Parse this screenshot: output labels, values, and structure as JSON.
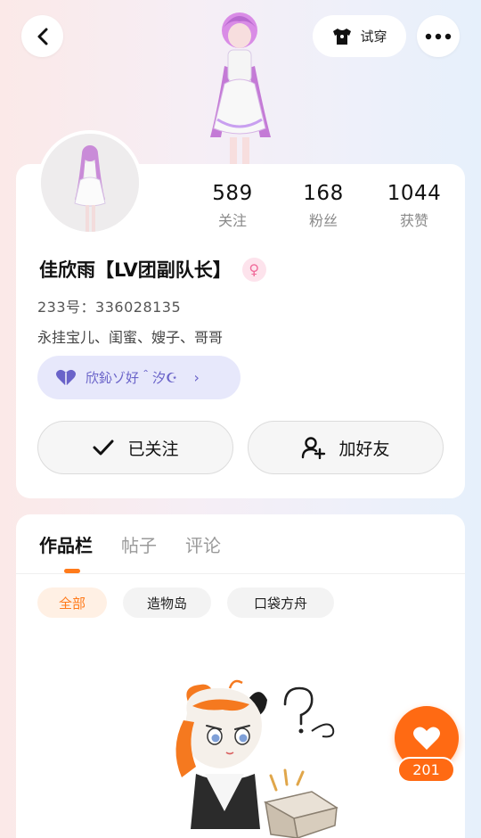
{
  "header": {
    "try_on_label": "试穿",
    "back_icon": "chevron-left-icon",
    "more_icon": "more-horizontal-icon",
    "shirt_icon": "tshirt-icon"
  },
  "stats": [
    {
      "value": "589",
      "label": "关注"
    },
    {
      "value": "168",
      "label": "粉丝"
    },
    {
      "value": "1044",
      "label": "获赞"
    }
  ],
  "profile": {
    "name": "佳欣雨【LV团副队长】",
    "gender": "female",
    "uid": "233号：336028135",
    "bio": "永挂宝儿、闺蜜、嫂子、哥哥",
    "fan_tag": "欣鈊ゾ好＾汐☪"
  },
  "actions": {
    "follow_label": "已关注",
    "add_friend_label": "加好友"
  },
  "tabs": [
    {
      "label": "作品栏",
      "active": true
    },
    {
      "label": "帖子",
      "active": false
    },
    {
      "label": "评论",
      "active": false
    }
  ],
  "filters": [
    {
      "label": "全部",
      "active": true
    },
    {
      "label": "造物岛",
      "active": false
    },
    {
      "label": "口袋方舟",
      "active": false
    }
  ],
  "like": {
    "count": "201"
  },
  "colors": {
    "accent": "#ff6a13",
    "fan_tag_bg": "#e7e8fb",
    "fan_tag_text": "#6a63c9"
  }
}
